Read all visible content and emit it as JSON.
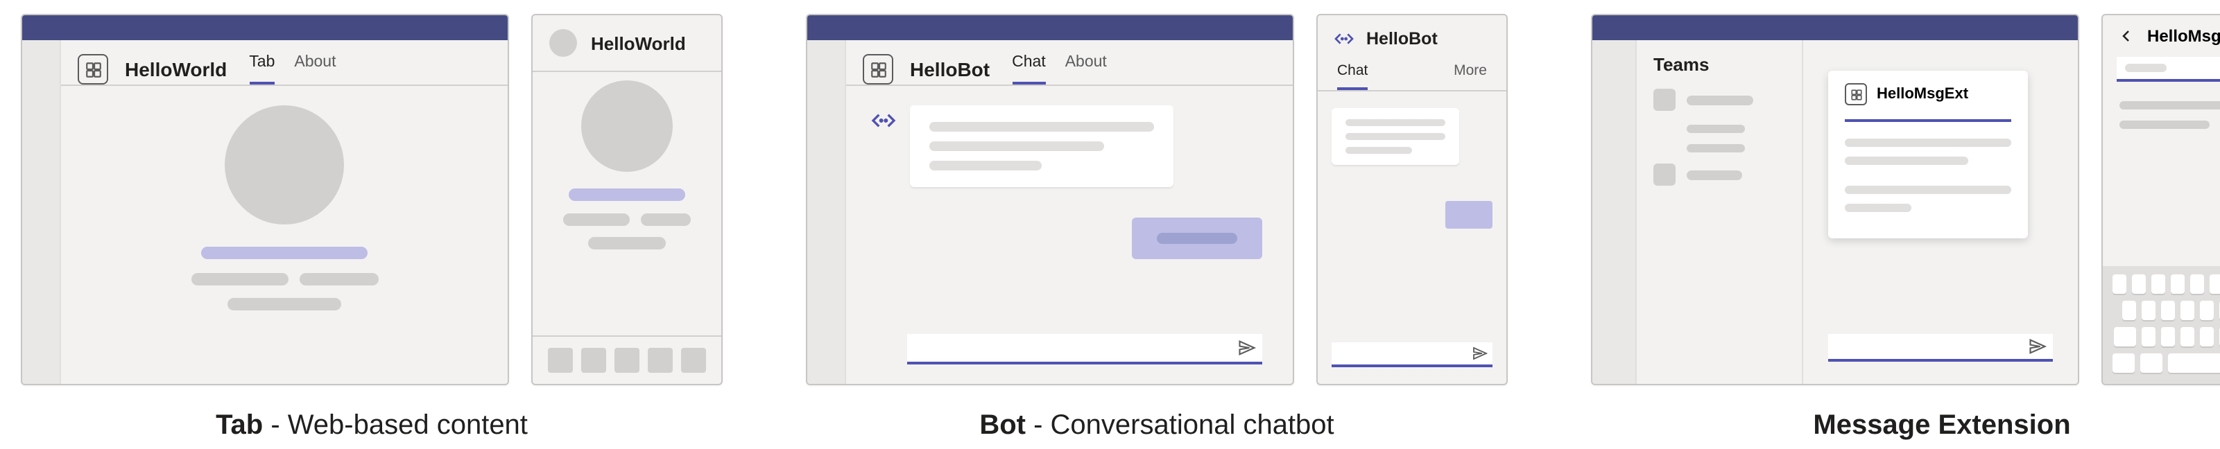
{
  "captions": {
    "tab_bold": "Tab",
    "tab_rest": " - Web-based content",
    "bot_bold": "Bot",
    "bot_rest": " - Conversational chatbot",
    "msgext": "Message Extension"
  },
  "tab": {
    "app_name": "HelloWorld",
    "tab_active": "Tab",
    "tab_about": "About",
    "mobile_title": "HelloWorld"
  },
  "bot": {
    "app_name": "HelloBot",
    "tab_chat": "Chat",
    "tab_about": "About",
    "mobile_title": "HelloBot",
    "mobile_tab_chat": "Chat",
    "mobile_tab_more": "More"
  },
  "msgext": {
    "teams_label": "Teams",
    "popup_title": "HelloMsgExt",
    "mobile_title": "HelloMsgExt"
  }
}
